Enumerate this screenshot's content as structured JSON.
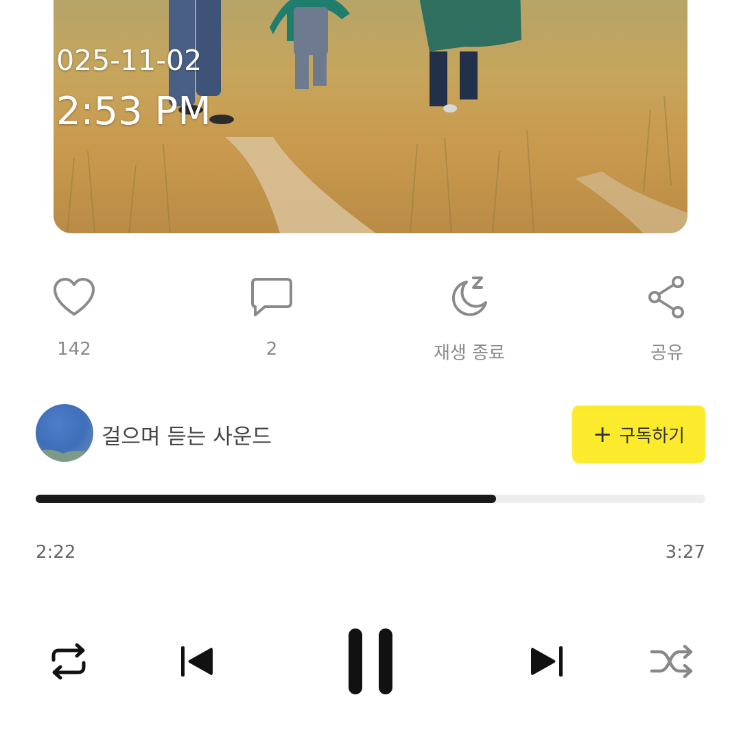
{
  "cover": {
    "date": "025-11-02",
    "time": "2:53 PM"
  },
  "actions": {
    "like": {
      "label": "142",
      "icon": "heart-icon"
    },
    "comment": {
      "label": "2",
      "icon": "comment-icon"
    },
    "sleep": {
      "label": "재생 종료",
      "icon": "sleep-timer-icon"
    },
    "share": {
      "label": "공유",
      "icon": "share-icon"
    }
  },
  "channel": {
    "name": "걸으며 듣는 사운드",
    "subscribe_label": "구독하기",
    "subscribe_color": "#fbeb2c"
  },
  "player": {
    "current_time": "2:22",
    "total_time": "3:27",
    "progress_fraction": 0.688,
    "controls": [
      "repeat-icon",
      "previous-icon",
      "pause-icon",
      "next-icon",
      "shuffle-icon"
    ]
  }
}
